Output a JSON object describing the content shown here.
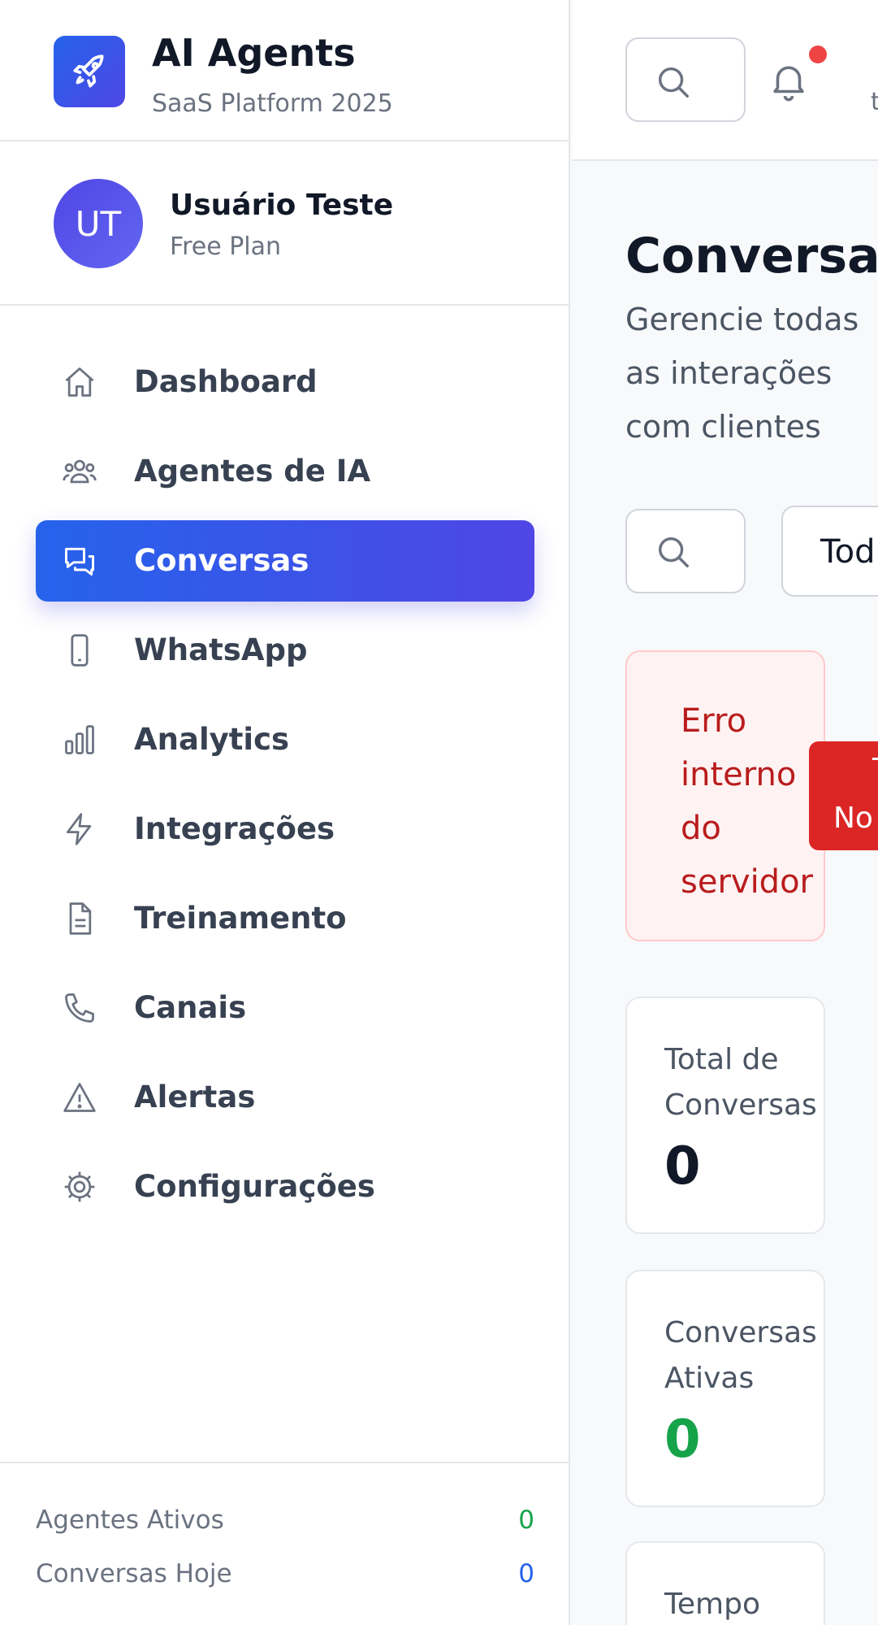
{
  "brand": {
    "title": "AI Agents",
    "subtitle": "SaaS Platform 2025"
  },
  "user": {
    "initials": "UT",
    "name": "Usuário Teste",
    "plan": "Free Plan"
  },
  "nav": {
    "items": [
      {
        "label": "Dashboard",
        "icon": "home-icon",
        "active": false
      },
      {
        "label": "Agentes de IA",
        "icon": "users-icon",
        "active": false
      },
      {
        "label": "Conversas",
        "icon": "chat-icon",
        "active": true
      },
      {
        "label": "WhatsApp",
        "icon": "phone-device-icon",
        "active": false
      },
      {
        "label": "Analytics",
        "icon": "bar-chart-icon",
        "active": false
      },
      {
        "label": "Integrações",
        "icon": "lightning-icon",
        "active": false
      },
      {
        "label": "Treinamento",
        "icon": "document-icon",
        "active": false
      },
      {
        "label": "Canais",
        "icon": "phone-icon",
        "active": false
      },
      {
        "label": "Alertas",
        "icon": "alert-icon",
        "active": false
      },
      {
        "label": "Configurações",
        "icon": "gear-icon",
        "active": false
      }
    ]
  },
  "stats": {
    "active_agents": {
      "label": "Agentes Ativos",
      "value": "0"
    },
    "conversations_today": {
      "label": "Conversas Hoje",
      "value": "0"
    }
  },
  "topbar": {
    "cut_text": "t"
  },
  "page": {
    "title": "Conversas",
    "subtitle": "Gerencie todas as interações com clientes"
  },
  "filters": {
    "status_select_value": "Tod"
  },
  "error": {
    "message": "Erro interno do servidor",
    "retry_line1": "T",
    "retry_line2": "No"
  },
  "cards": [
    {
      "label": "Total de Conversas",
      "value": "0"
    },
    {
      "label": "Conversas Ativas",
      "value": "0"
    },
    {
      "label": "Tempo",
      "value": ""
    }
  ],
  "colors": {
    "primary": "#2563eb",
    "accent": "#4f46e5",
    "success": "#16a34a",
    "info": "#2563eb",
    "danger": "#dc2626",
    "error_text": "#b91c1c"
  }
}
